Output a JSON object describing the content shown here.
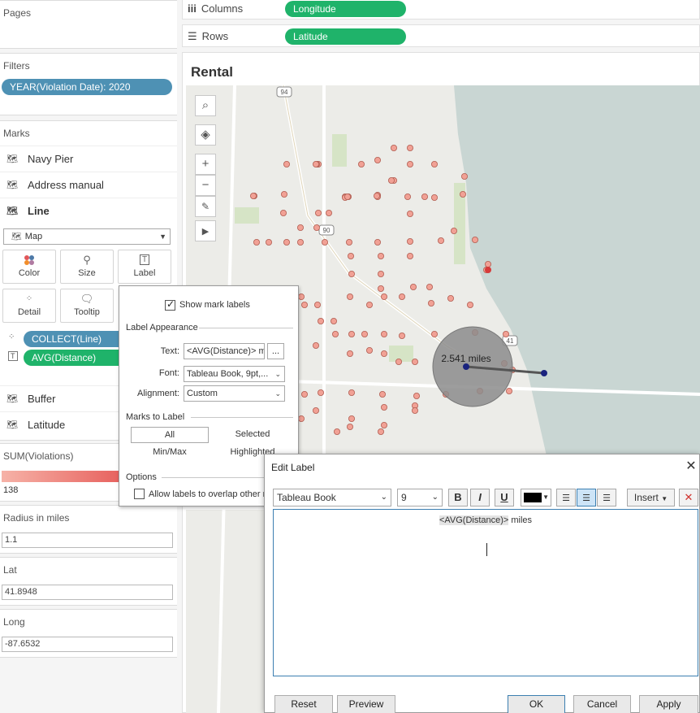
{
  "left": {
    "pages": {
      "title": "Pages"
    },
    "filters": {
      "title": "Filters",
      "pill": "YEAR(Violation Date): 2020"
    },
    "marks": {
      "title": "Marks",
      "layers": [
        {
          "label": "Navy Pier",
          "icon": "map-layer-icon"
        },
        {
          "label": "Address manual",
          "icon": "map-layer-icon"
        },
        {
          "label": "Line",
          "icon": "map-layer-icon"
        }
      ],
      "mark_type": "Map",
      "buttons": [
        "Color",
        "Size",
        "Label",
        "Detail",
        "Tooltip"
      ],
      "fields": [
        {
          "label": "COLLECT(Line)",
          "color": "#4e91b4"
        },
        {
          "label": "AVG(Distance)",
          "color": "#1fb36a"
        }
      ],
      "more_layers": [
        {
          "label": "Buffer",
          "icon": "map-layer-icon"
        },
        {
          "label": "Latitude",
          "icon": "map-layer-icon"
        }
      ]
    },
    "legend": {
      "title": "SUM(Violations)",
      "min": "138"
    },
    "params": [
      {
        "title": "Radius in miles",
        "value": "1.1"
      },
      {
        "title": "Lat",
        "value": "41.8948"
      },
      {
        "title": "Long",
        "value": "-87.6532"
      }
    ]
  },
  "shelves": {
    "columns": {
      "label": "Columns",
      "pill": "Longitude"
    },
    "rows": {
      "label": "Rows",
      "pill": "Latitude"
    }
  },
  "view": {
    "title": "Rental",
    "distance_label": "2.541 miles",
    "map_controls": [
      "search-icon",
      "layers-icon",
      "zoom-in-icon",
      "zoom-out-icon",
      "pin-icon",
      "play-icon"
    ],
    "road_shields": [
      "94",
      "90",
      "41"
    ]
  },
  "label_popup": {
    "show_mark_labels": "Show mark labels",
    "appearance_title": "Label Appearance",
    "text_label": "Text:",
    "text_value": "<AVG(Distance)> m",
    "ellipsis": "...",
    "font_label": "Font:",
    "font_value": "Tableau Book, 9pt,...",
    "alignment_label": "Alignment:",
    "alignment_value": "Custom",
    "marks_to_label_title": "Marks to Label",
    "options": [
      "All",
      "Selected",
      "Min/Max",
      "Highlighted"
    ],
    "options_title": "Options",
    "allow_overlap": "Allow labels to overlap other m"
  },
  "edit_label": {
    "title": "Edit Label",
    "font": "Tableau Book",
    "size": "9",
    "bold": "B",
    "italic": "I",
    "underline": "U",
    "insert": "Insert",
    "token": "<AVG(Distance)>",
    "suffix": " miles",
    "reset": "Reset",
    "preview": "Preview",
    "ok": "OK",
    "cancel": "Cancel",
    "apply": "Apply"
  }
}
